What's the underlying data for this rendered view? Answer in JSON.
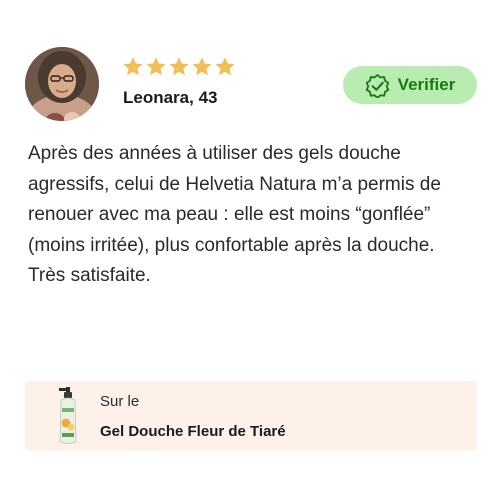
{
  "review": {
    "reviewer": "Leonara, 43",
    "rating": 5,
    "rating_max": 5,
    "star_color": "#F2BE57",
    "verify_label": "Verifier",
    "verify_bg": "#B8ECB1",
    "verify_color": "#197A12",
    "text": "Après des années à utiliser des gels douche agressifs, celui de Helvetia Natura m’a permis de renouer avec ma peau : elle est moins “gonflée” (moins irritée), plus confortable après la douche. Très satisfaite."
  },
  "product": {
    "prefix": "Sur le",
    "name": "Gel Douche Fleur de Tiaré",
    "card_bg": "#FDF1EA"
  },
  "icons": {
    "avatar": "reviewer-avatar",
    "star": "star-icon",
    "verified": "verified-badge-icon",
    "product": "product-bottle-image"
  }
}
